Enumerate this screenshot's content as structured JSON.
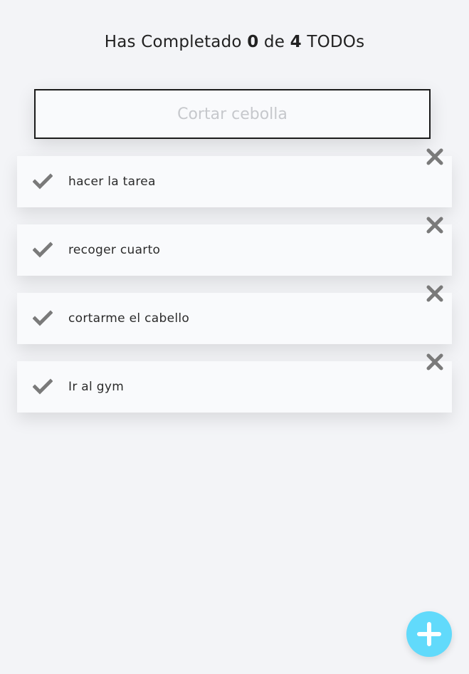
{
  "counter": {
    "prefix": "Has Completado",
    "completed": "0",
    "middle": "de",
    "total": "4",
    "suffix": "TODOs"
  },
  "search": {
    "placeholder": "Cortar cebolla",
    "value": ""
  },
  "todos": [
    {
      "text": "hacer la tarea"
    },
    {
      "text": "recoger cuarto"
    },
    {
      "text": "cortarme el cabello"
    },
    {
      "text": "Ir al gym"
    }
  ],
  "colors": {
    "background": "#f3f4f7",
    "card": "#f9fafc",
    "icon": "#7a7a7a",
    "fab": "#61dafb"
  },
  "icons": {
    "check": "check-icon",
    "delete": "close-icon",
    "add": "plus-icon"
  }
}
